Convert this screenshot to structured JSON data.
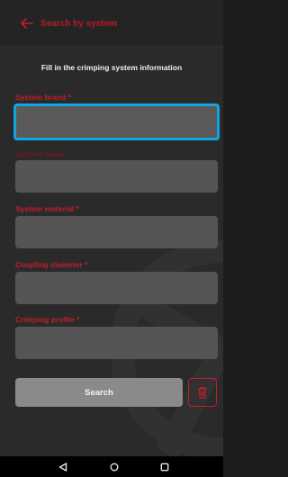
{
  "header": {
    "title": "Search by system",
    "back_icon": "arrow-left-icon"
  },
  "form": {
    "heading": "Fill in the crimping system information",
    "fields": [
      {
        "label": "System brand *",
        "value": ""
      },
      {
        "label": "System name",
        "value": ""
      },
      {
        "label": "System material *",
        "value": ""
      },
      {
        "label": "Coupling diameter *",
        "value": ""
      },
      {
        "label": "Crimping profile *",
        "value": ""
      }
    ],
    "search_label": "Search",
    "clear_icon": "trash-icon"
  },
  "colors": {
    "accent": "#c11f2a",
    "focus": "#0fa6e2",
    "background": "#2a2a2a"
  },
  "navbar": {
    "icons": [
      "nav-back-icon",
      "nav-home-icon",
      "nav-recents-icon"
    ]
  }
}
